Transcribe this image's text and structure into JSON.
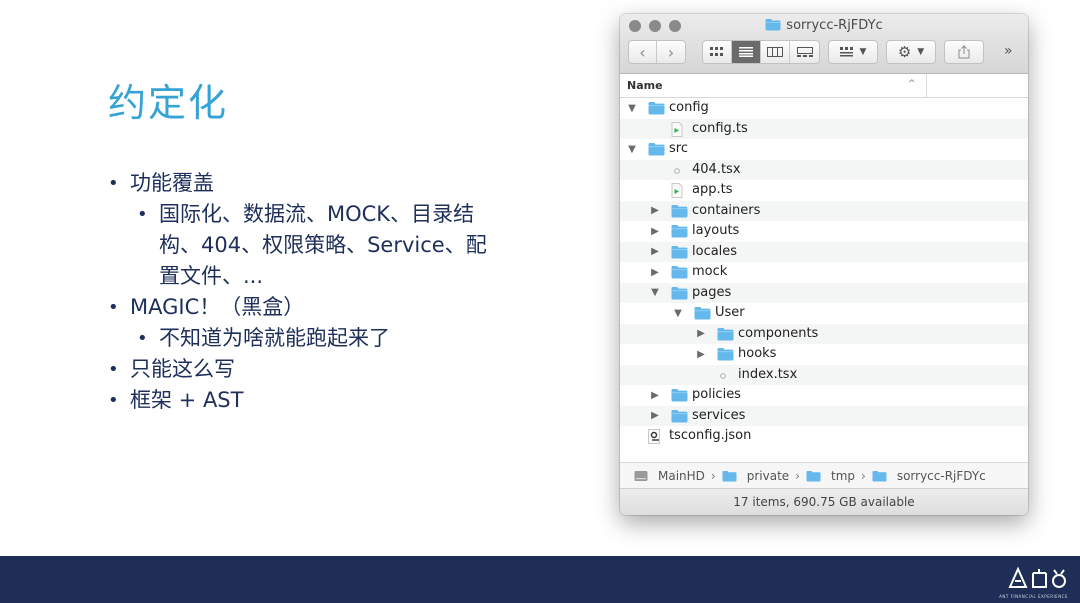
{
  "slide": {
    "title": "约定化",
    "bullets": [
      {
        "text": "功能覆盖",
        "level": 1
      },
      {
        "text": "国际化、数据流、MOCK、目录结构、404、权限策略、Service、配置文件、...",
        "level": 2
      },
      {
        "text": "MAGIC！（黑盒）",
        "level": 1
      },
      {
        "text": "不知道为啥就能跑起来了",
        "level": 2
      },
      {
        "text": "只能这么写",
        "level": 1
      },
      {
        "text": "框架 + AST",
        "level": 1
      }
    ]
  },
  "footer": {
    "logo_icon": "ant-financial-logo",
    "logo_text": "ANT FINANCIAL EXPERIENCE",
    "background": "#1f2e57"
  },
  "finder": {
    "title": "sorrycc-RjFDYc",
    "column_header": "Name",
    "sort_indicator": "^",
    "toolbar": {
      "back": "‹",
      "forward": "›",
      "view_modes": [
        "icon-view",
        "list-view",
        "column-view",
        "gallery-view"
      ],
      "active_view": "list-view",
      "group_menu": "group-by",
      "action_menu": "gear",
      "share": "share",
      "more": "»"
    },
    "rows": [
      {
        "name": "config",
        "indent": 0,
        "type": "folder",
        "state": "expanded"
      },
      {
        "name": "config.ts",
        "indent": 1,
        "type": "ts-file",
        "state": ""
      },
      {
        "name": "src",
        "indent": 0,
        "type": "folder",
        "state": "expanded"
      },
      {
        "name": "404.tsx",
        "indent": 1,
        "type": "file",
        "state": ""
      },
      {
        "name": "app.ts",
        "indent": 1,
        "type": "ts-file",
        "state": ""
      },
      {
        "name": "containers",
        "indent": 1,
        "type": "folder",
        "state": "collapsed"
      },
      {
        "name": "layouts",
        "indent": 1,
        "type": "folder",
        "state": "collapsed"
      },
      {
        "name": "locales",
        "indent": 1,
        "type": "folder",
        "state": "collapsed"
      },
      {
        "name": "mock",
        "indent": 1,
        "type": "folder",
        "state": "collapsed"
      },
      {
        "name": "pages",
        "indent": 1,
        "type": "folder",
        "state": "expanded"
      },
      {
        "name": "User",
        "indent": 2,
        "type": "folder",
        "state": "expanded"
      },
      {
        "name": "components",
        "indent": 3,
        "type": "folder",
        "state": "collapsed"
      },
      {
        "name": "hooks",
        "indent": 3,
        "type": "folder",
        "state": "collapsed"
      },
      {
        "name": "index.tsx",
        "indent": 3,
        "type": "file",
        "state": ""
      },
      {
        "name": "policies",
        "indent": 1,
        "type": "folder",
        "state": "collapsed"
      },
      {
        "name": "services",
        "indent": 1,
        "type": "folder",
        "state": "collapsed"
      },
      {
        "name": "tsconfig.json",
        "indent": 0,
        "type": "json-file",
        "state": ""
      }
    ],
    "path": [
      {
        "name": "MainHD",
        "type": "disk"
      },
      {
        "name": "private",
        "type": "folder"
      },
      {
        "name": "tmp",
        "type": "folder"
      },
      {
        "name": "sorrycc-RjFDYc",
        "type": "folder"
      }
    ],
    "status": "17 items, 690.75 GB available"
  },
  "colors": {
    "title": "#35a3d6",
    "bullet_text": "#1d2f5a",
    "folder": "#64b8ec"
  }
}
